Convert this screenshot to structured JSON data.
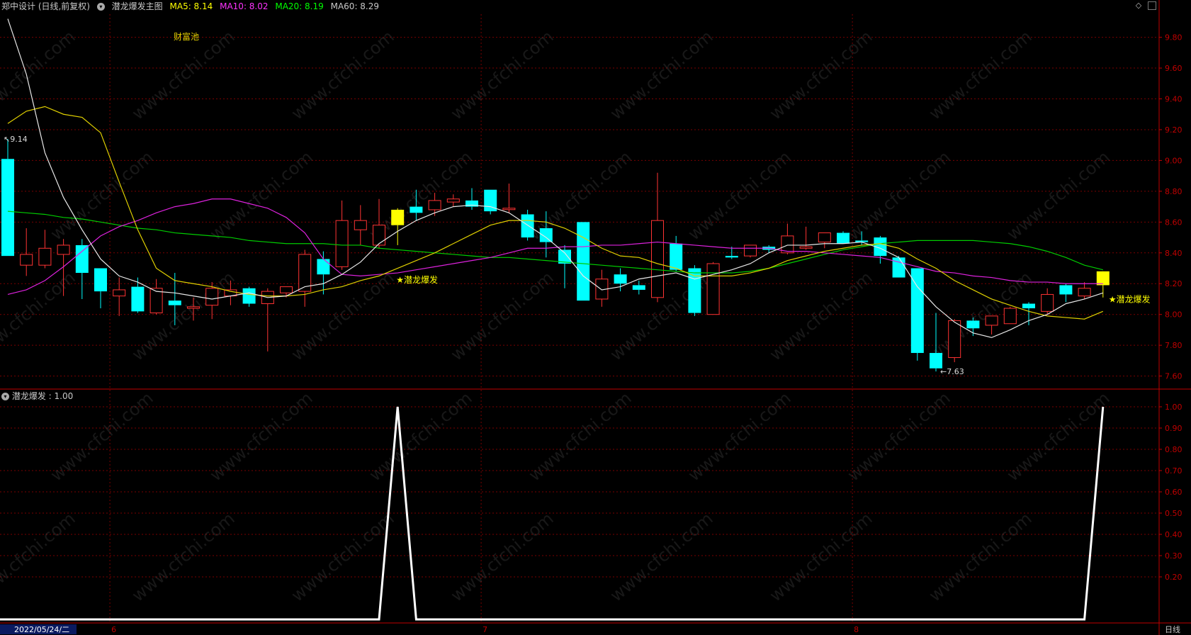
{
  "header": {
    "stock": "郑中设计 (日线,前复权)",
    "indicator": "潜龙爆发主图",
    "ma5": "MA5: 8.14",
    "ma10": "MA10: 8.02",
    "ma20": "MA20: 8.19",
    "ma60": "MA60: 8.29",
    "ma5_color": "#ffff00",
    "ma10_color": "#ff33ff",
    "ma20_color": "#00ff00",
    "ma60_color": "#c8c8c8"
  },
  "sub_header": {
    "label": "潜龙爆发 : 1.00"
  },
  "annotations": {
    "pool": "财富池",
    "signal1": "★潜龙爆发",
    "signal2": "★潜龙爆发",
    "high": "9.14",
    "low": "7.63"
  },
  "x_axis": {
    "date": "2022/05/24/二",
    "months": [
      "6",
      "7",
      "8"
    ],
    "period": "日线"
  },
  "watermark": "www.cfchi.com",
  "colors": {
    "up": "#ff3333",
    "down": "#00ffff",
    "signal_bar": "#ffff00",
    "grid": "#7a0000",
    "axis": "#c00000"
  },
  "chart_data": [
    {
      "type": "candlestick",
      "y_ticks": [
        "9.80",
        "9.60",
        "9.40",
        "9.20",
        "9.00",
        "8.80",
        "8.60",
        "8.40",
        "8.20",
        "8.00",
        "7.80",
        "7.60"
      ],
      "ylim": [
        7.52,
        9.95
      ],
      "candles": [
        {
          "o": 9.01,
          "h": 9.14,
          "l": 8.38,
          "c": 8.38,
          "s": 0
        },
        {
          "o": 8.32,
          "h": 8.56,
          "l": 8.25,
          "c": 8.39,
          "s": 0
        },
        {
          "o": 8.32,
          "h": 8.55,
          "l": 8.3,
          "c": 8.43,
          "s": 0
        },
        {
          "o": 8.39,
          "h": 8.49,
          "l": 8.12,
          "c": 8.45,
          "s": 0
        },
        {
          "o": 8.45,
          "h": 8.49,
          "l": 8.1,
          "c": 8.27,
          "s": 0
        },
        {
          "o": 8.3,
          "h": 8.3,
          "l": 8.04,
          "c": 8.15,
          "s": 0
        },
        {
          "o": 8.12,
          "h": 8.24,
          "l": 7.99,
          "c": 8.16,
          "s": 0
        },
        {
          "o": 8.18,
          "h": 8.24,
          "l": 8.01,
          "c": 8.02,
          "s": 0
        },
        {
          "o": 8.01,
          "h": 8.23,
          "l": 8.0,
          "c": 8.17,
          "s": 0
        },
        {
          "o": 8.09,
          "h": 8.27,
          "l": 7.93,
          "c": 8.06,
          "s": 0
        },
        {
          "o": 8.04,
          "h": 8.11,
          "l": 7.96,
          "c": 8.05,
          "s": 0
        },
        {
          "o": 8.06,
          "h": 8.21,
          "l": 7.97,
          "c": 8.17,
          "s": 0
        },
        {
          "o": 8.12,
          "h": 8.22,
          "l": 8.06,
          "c": 8.16,
          "s": 0
        },
        {
          "o": 8.17,
          "h": 8.18,
          "l": 8.05,
          "c": 8.07,
          "s": 0
        },
        {
          "o": 8.07,
          "h": 8.17,
          "l": 7.76,
          "c": 8.15,
          "s": 0
        },
        {
          "o": 8.14,
          "h": 8.18,
          "l": 8.11,
          "c": 8.18,
          "s": 0
        },
        {
          "o": 8.15,
          "h": 8.42,
          "l": 8.05,
          "c": 8.39,
          "s": 0
        },
        {
          "o": 8.36,
          "h": 8.41,
          "l": 8.13,
          "c": 8.26,
          "s": 0
        },
        {
          "o": 8.31,
          "h": 8.74,
          "l": 8.29,
          "c": 8.61,
          "s": 0
        },
        {
          "o": 8.55,
          "h": 8.71,
          "l": 8.45,
          "c": 8.61,
          "s": 0
        },
        {
          "o": 8.45,
          "h": 8.75,
          "l": 8.43,
          "c": 8.58,
          "s": 0
        },
        {
          "o": 8.58,
          "h": 8.69,
          "l": 8.45,
          "c": 8.68,
          "s": 1
        },
        {
          "o": 8.7,
          "h": 8.81,
          "l": 8.61,
          "c": 8.66,
          "s": 0
        },
        {
          "o": 8.68,
          "h": 8.79,
          "l": 8.64,
          "c": 8.74,
          "s": 0
        },
        {
          "o": 8.73,
          "h": 8.78,
          "l": 8.7,
          "c": 8.75,
          "s": 0
        },
        {
          "o": 8.74,
          "h": 8.82,
          "l": 8.68,
          "c": 8.7,
          "s": 0
        },
        {
          "o": 8.81,
          "h": 8.81,
          "l": 8.65,
          "c": 8.67,
          "s": 0
        },
        {
          "o": 8.69,
          "h": 8.85,
          "l": 8.66,
          "c": 8.69,
          "s": 0
        },
        {
          "o": 8.65,
          "h": 8.68,
          "l": 8.48,
          "c": 8.5,
          "s": 0
        },
        {
          "o": 8.56,
          "h": 8.67,
          "l": 8.37,
          "c": 8.47,
          "s": 0
        },
        {
          "o": 8.42,
          "h": 8.45,
          "l": 8.17,
          "c": 8.33,
          "s": 0
        },
        {
          "o": 8.6,
          "h": 8.6,
          "l": 8.09,
          "c": 8.09,
          "s": 0
        },
        {
          "o": 8.1,
          "h": 8.29,
          "l": 8.05,
          "c": 8.23,
          "s": 0
        },
        {
          "o": 8.26,
          "h": 8.3,
          "l": 8.15,
          "c": 8.2,
          "s": 0
        },
        {
          "o": 8.19,
          "h": 8.22,
          "l": 8.13,
          "c": 8.16,
          "s": 0
        },
        {
          "o": 8.11,
          "h": 8.92,
          "l": 8.08,
          "c": 8.61,
          "s": 0
        },
        {
          "o": 8.46,
          "h": 8.51,
          "l": 8.28,
          "c": 8.29,
          "s": 0
        },
        {
          "o": 8.3,
          "h": 8.32,
          "l": 7.99,
          "c": 8.01,
          "s": 0
        },
        {
          "o": 8.0,
          "h": 8.34,
          "l": 8.0,
          "c": 8.33,
          "s": 0
        },
        {
          "o": 8.38,
          "h": 8.44,
          "l": 8.36,
          "c": 8.37,
          "s": 0
        },
        {
          "o": 8.38,
          "h": 8.45,
          "l": 8.37,
          "c": 8.45,
          "s": 0
        },
        {
          "o": 8.44,
          "h": 8.45,
          "l": 8.4,
          "c": 8.42,
          "s": 0
        },
        {
          "o": 8.4,
          "h": 8.59,
          "l": 8.39,
          "c": 8.51,
          "s": 0
        },
        {
          "o": 8.43,
          "h": 8.57,
          "l": 8.42,
          "c": 8.44,
          "s": 0
        },
        {
          "o": 8.47,
          "h": 8.53,
          "l": 8.43,
          "c": 8.53,
          "s": 0
        },
        {
          "o": 8.53,
          "h": 8.54,
          "l": 8.46,
          "c": 8.46,
          "s": 0
        },
        {
          "o": 8.48,
          "h": 8.54,
          "l": 8.45,
          "c": 8.47,
          "s": 0
        },
        {
          "o": 8.5,
          "h": 8.51,
          "l": 8.33,
          "c": 8.38,
          "s": 0
        },
        {
          "o": 8.37,
          "h": 8.38,
          "l": 8.24,
          "c": 8.24,
          "s": 0
        },
        {
          "o": 8.3,
          "h": 8.3,
          "l": 7.7,
          "c": 7.75,
          "s": 0
        },
        {
          "o": 7.75,
          "h": 8.01,
          "l": 7.63,
          "c": 7.65,
          "s": 0
        },
        {
          "o": 7.72,
          "h": 7.97,
          "l": 7.69,
          "c": 7.96,
          "s": 0
        },
        {
          "o": 7.96,
          "h": 7.98,
          "l": 7.86,
          "c": 7.91,
          "s": 0
        },
        {
          "o": 7.93,
          "h": 7.99,
          "l": 7.87,
          "c": 7.99,
          "s": 0
        },
        {
          "o": 7.94,
          "h": 8.05,
          "l": 7.94,
          "c": 8.04,
          "s": 0
        },
        {
          "o": 8.07,
          "h": 8.08,
          "l": 7.93,
          "c": 8.04,
          "s": 0
        },
        {
          "o": 8.02,
          "h": 8.17,
          "l": 8.0,
          "c": 8.13,
          "s": 0
        },
        {
          "o": 8.19,
          "h": 8.2,
          "l": 8.08,
          "c": 8.13,
          "s": 0
        },
        {
          "o": 8.12,
          "h": 8.21,
          "l": 8.1,
          "c": 8.17,
          "s": 0
        },
        {
          "o": 8.19,
          "h": 8.27,
          "l": 8.11,
          "c": 8.28,
          "s": 1
        }
      ],
      "ma_white": [
        9.92,
        9.56,
        9.05,
        8.76,
        8.55,
        8.36,
        8.25,
        8.21,
        8.15,
        8.14,
        8.12,
        8.1,
        8.12,
        8.14,
        8.11,
        8.12,
        8.18,
        8.2,
        8.26,
        8.34,
        8.46,
        8.54,
        8.61,
        8.66,
        8.7,
        8.71,
        8.7,
        8.66,
        8.58,
        8.5,
        8.4,
        8.25,
        8.16,
        8.18,
        8.23,
        8.25,
        8.27,
        8.23,
        8.26,
        8.29,
        8.33,
        8.4,
        8.45,
        8.45,
        8.46,
        8.46,
        8.47,
        8.43,
        8.37,
        8.18,
        8.05,
        7.95,
        7.88,
        7.85,
        7.9,
        7.96,
        8.0,
        8.07,
        8.1,
        8.14
      ],
      "ma_yellow": [
        9.24,
        9.32,
        9.35,
        9.3,
        9.28,
        9.18,
        8.86,
        8.55,
        8.3,
        8.22,
        8.2,
        8.18,
        8.15,
        8.13,
        8.12,
        8.12,
        8.13,
        8.16,
        8.18,
        8.22,
        8.25,
        8.3,
        8.35,
        8.4,
        8.46,
        8.52,
        8.58,
        8.61,
        8.61,
        8.6,
        8.56,
        8.5,
        8.43,
        8.38,
        8.37,
        8.33,
        8.3,
        8.25,
        8.25,
        8.25,
        8.27,
        8.3,
        8.35,
        8.38,
        8.41,
        8.43,
        8.45,
        8.46,
        8.43,
        8.36,
        8.3,
        8.22,
        8.16,
        8.1,
        8.06,
        8.02,
        7.99,
        7.98,
        7.97,
        8.02
      ],
      "ma_magenta": [
        8.13,
        8.16,
        8.22,
        8.31,
        8.41,
        8.51,
        8.57,
        8.61,
        8.66,
        8.7,
        8.72,
        8.75,
        8.75,
        8.72,
        8.69,
        8.63,
        8.53,
        8.36,
        8.26,
        8.25,
        8.26,
        8.27,
        8.29,
        8.31,
        8.33,
        8.35,
        8.37,
        8.4,
        8.43,
        8.43,
        8.44,
        8.44,
        8.45,
        8.45,
        8.46,
        8.47,
        8.46,
        8.45,
        8.44,
        8.43,
        8.43,
        8.43,
        8.41,
        8.41,
        8.4,
        8.39,
        8.38,
        8.37,
        8.34,
        8.31,
        8.28,
        8.27,
        8.25,
        8.24,
        8.22,
        8.21,
        8.21,
        8.2,
        8.2,
        8.2
      ],
      "ma_green": [
        8.67,
        8.66,
        8.65,
        8.63,
        8.62,
        8.6,
        8.58,
        8.56,
        8.55,
        8.53,
        8.52,
        8.51,
        8.5,
        8.48,
        8.47,
        8.46,
        8.46,
        8.46,
        8.45,
        8.45,
        8.43,
        8.42,
        8.41,
        8.4,
        8.39,
        8.38,
        8.37,
        8.37,
        8.36,
        8.35,
        8.34,
        8.33,
        8.32,
        8.31,
        8.3,
        8.29,
        8.28,
        8.27,
        8.27,
        8.27,
        8.28,
        8.3,
        8.33,
        8.36,
        8.39,
        8.42,
        8.44,
        8.46,
        8.47,
        8.48,
        8.48,
        8.48,
        8.48,
        8.47,
        8.46,
        8.44,
        8.41,
        8.37,
        8.32,
        8.29
      ]
    },
    {
      "type": "line",
      "title": "潜龙爆发",
      "y_ticks": [
        "1.00",
        "0.90",
        "0.80",
        "0.70",
        "0.60",
        "0.50",
        "0.40",
        "0.30",
        "0.20"
      ],
      "ylim": [
        0,
        1.0
      ],
      "values": [
        0,
        0,
        0,
        0,
        0,
        0,
        0,
        0,
        0,
        0,
        0,
        0,
        0,
        0,
        0,
        0,
        0,
        0,
        0,
        0,
        0,
        1,
        0,
        0,
        0,
        0,
        0,
        0,
        0,
        0,
        0,
        0,
        0,
        0,
        0,
        0,
        0,
        0,
        0,
        0,
        0,
        0,
        0,
        0,
        0,
        0,
        0,
        0,
        0,
        0,
        0,
        0,
        0,
        0,
        0,
        0,
        0,
        0,
        0,
        1
      ]
    }
  ]
}
